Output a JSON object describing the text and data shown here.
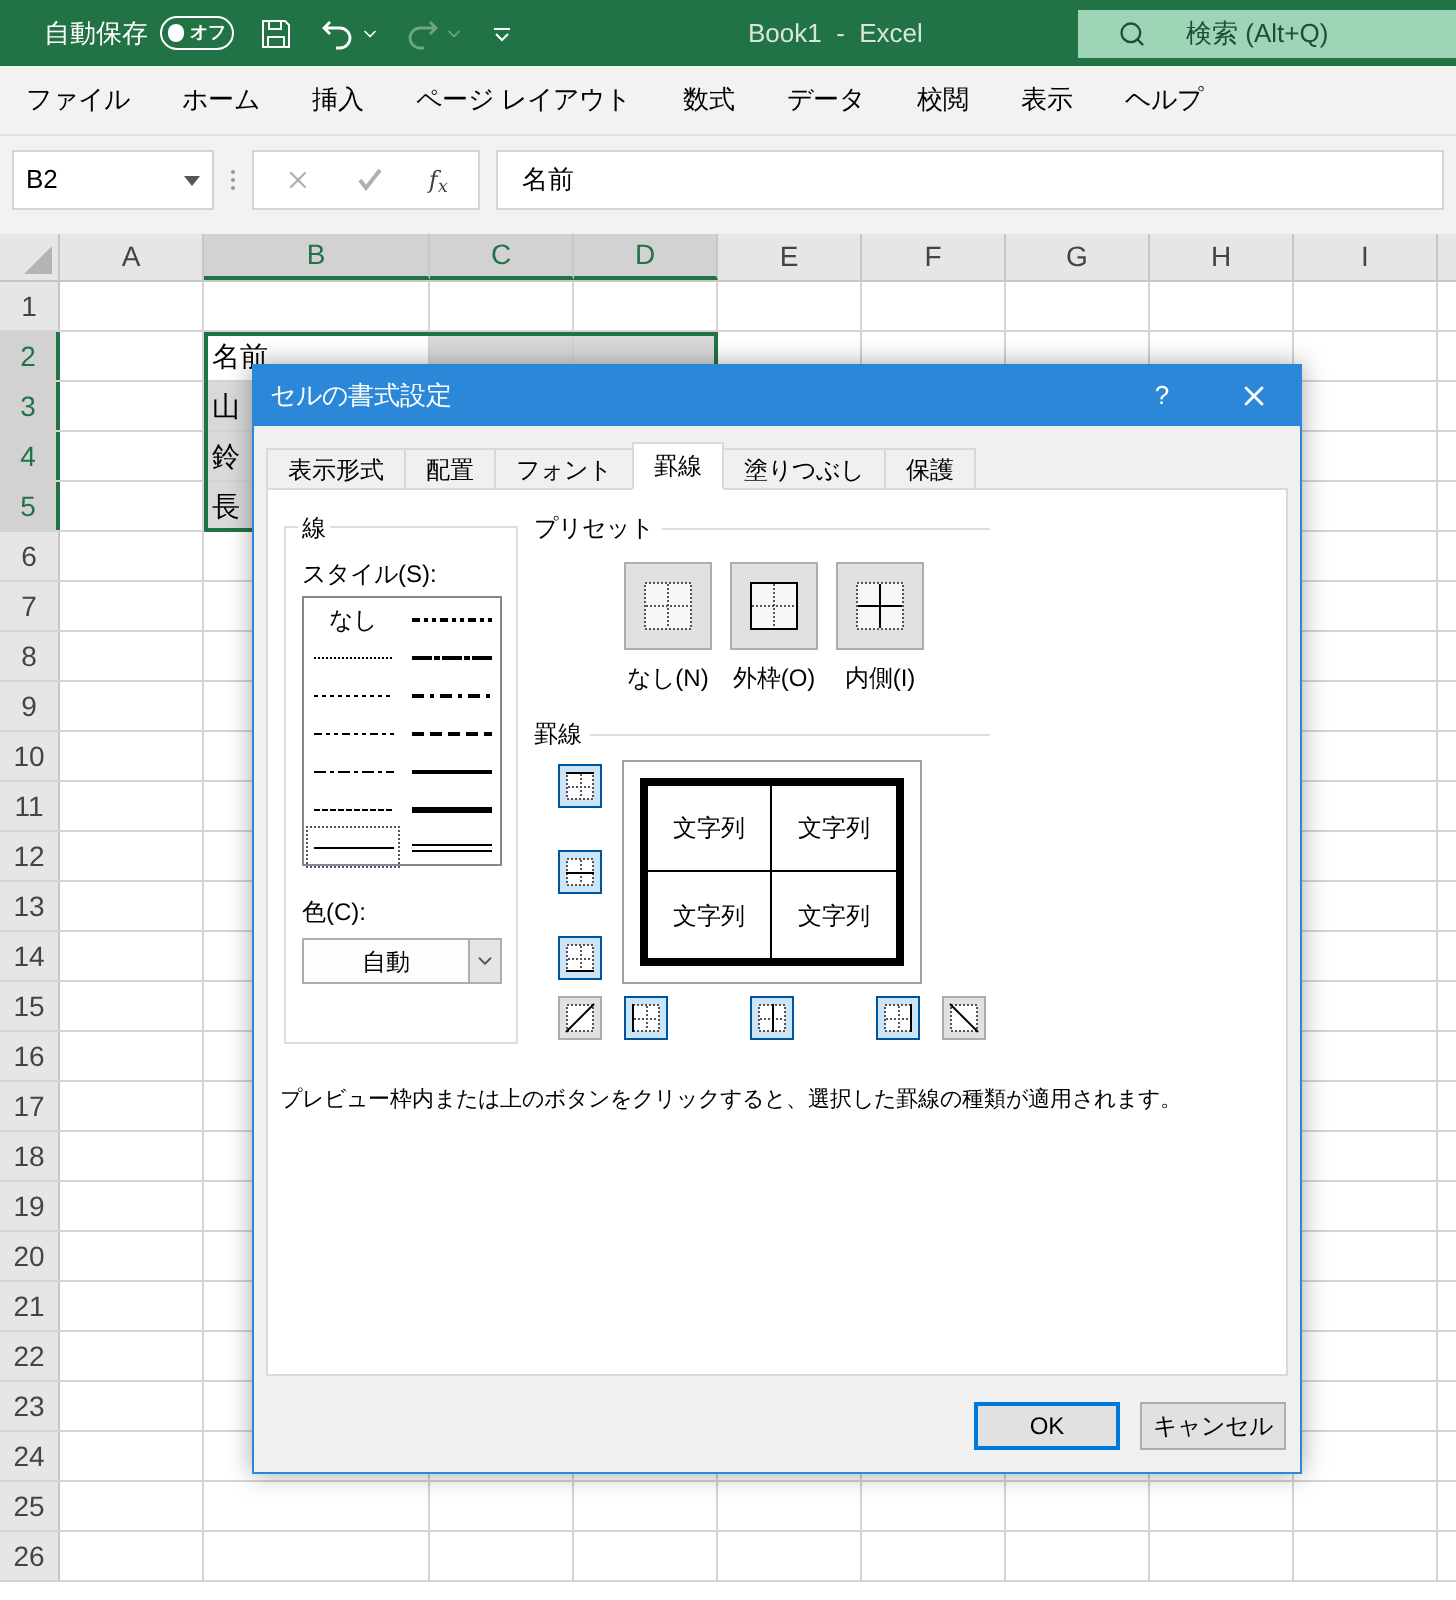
{
  "titlebar": {
    "autosave_label": "自動保存",
    "autosave": {
      "on": false,
      "label": "オフ"
    },
    "title": "Book1  -  Excel",
    "search": {
      "placeholder": "検索 (Alt+Q)"
    },
    "redo_disabled": true
  },
  "menu": [
    "ファイル",
    "ホーム",
    "挿入",
    "ページ レイアウト",
    "数式",
    "データ",
    "校閲",
    "表示",
    "ヘルプ"
  ],
  "formula_bar": {
    "name_box": "B2",
    "fx": "f$_{x}$",
    "value": "名前"
  },
  "sheet": {
    "columns": [
      {
        "label": "A",
        "selected": false
      },
      {
        "label": "B",
        "selected": true
      },
      {
        "label": "C",
        "selected": true
      },
      {
        "label": "D",
        "selected": true
      },
      {
        "label": "E",
        "selected": false
      },
      {
        "label": "F",
        "selected": false
      },
      {
        "label": "G",
        "selected": false
      },
      {
        "label": "H",
        "selected": false
      },
      {
        "label": "I",
        "selected": false
      }
    ],
    "rows": [
      {
        "label": "1",
        "selected": false
      },
      {
        "label": "2",
        "selected": true,
        "cells": [
          null,
          {
            "text": "名前",
            "selected": false
          },
          {
            "selected": true
          },
          {
            "selected": true
          }
        ]
      },
      {
        "label": "3",
        "selected": true,
        "cells": [
          null,
          {
            "text": "山",
            "selected": true
          }
        ]
      },
      {
        "label": "4",
        "selected": true,
        "cells": [
          null,
          {
            "text": "鈴",
            "selected": true
          }
        ]
      },
      {
        "label": "5",
        "selected": true,
        "cells": [
          null,
          {
            "text": "長",
            "selected": true
          }
        ]
      },
      {
        "label": "6",
        "selected": false
      },
      {
        "label": "7",
        "selected": false
      },
      {
        "label": "8",
        "selected": false
      },
      {
        "label": "9",
        "selected": false
      },
      {
        "label": "10",
        "selected": false
      },
      {
        "label": "11",
        "selected": false
      },
      {
        "label": "12",
        "selected": false
      },
      {
        "label": "13",
        "selected": false
      },
      {
        "label": "14",
        "selected": false
      },
      {
        "label": "15",
        "selected": false
      },
      {
        "label": "16",
        "selected": false
      },
      {
        "label": "17",
        "selected": false
      },
      {
        "label": "18",
        "selected": false
      },
      {
        "label": "19",
        "selected": false
      },
      {
        "label": "20",
        "selected": false
      },
      {
        "label": "21",
        "selected": false
      },
      {
        "label": "22",
        "selected": false
      },
      {
        "label": "23",
        "selected": false
      },
      {
        "label": "24",
        "selected": false
      },
      {
        "label": "25",
        "selected": false
      },
      {
        "label": "26",
        "selected": false
      }
    ]
  },
  "dialog": {
    "title": "セルの書式設定",
    "help": "?",
    "tabs": [
      {
        "label": "表示形式",
        "selected": false
      },
      {
        "label": "配置",
        "selected": false
      },
      {
        "label": "フォント",
        "selected": false
      },
      {
        "label": "罫線",
        "selected": true
      },
      {
        "label": "塗りつぶし",
        "selected": false
      },
      {
        "label": "保護",
        "selected": false
      }
    ],
    "line_group": {
      "title": "線",
      "style_label": "スタイル(S):",
      "styles": [
        {
          "kind": "none",
          "label": "なし",
          "selected": false
        },
        {
          "kind": "medium-dash-dot-dot",
          "selected": false
        },
        {
          "kind": "hair",
          "selected": false
        },
        {
          "kind": "slant-dash-dot",
          "selected": false
        },
        {
          "kind": "dotted",
          "selected": false
        },
        {
          "kind": "medium-dash-dot",
          "selected": false
        },
        {
          "kind": "dash-dot-dot",
          "selected": false
        },
        {
          "kind": "medium-dashed",
          "selected": false
        },
        {
          "kind": "dash-dot",
          "selected": false
        },
        {
          "kind": "medium",
          "selected": false
        },
        {
          "kind": "dashed",
          "selected": false
        },
        {
          "kind": "thick",
          "selected": false
        },
        {
          "kind": "thin",
          "selected": true
        },
        {
          "kind": "double",
          "selected": false
        }
      ],
      "color_label": "色(C):",
      "color_value": "自動"
    },
    "preset_title": "プリセット",
    "presets": [
      {
        "kind": "none",
        "label": "なし(N)"
      },
      {
        "kind": "outline",
        "label": "外枠(O)"
      },
      {
        "kind": "inside",
        "label": "内側(I)"
      }
    ],
    "border_title": "罫線",
    "border_buttons": [
      {
        "kind": "top",
        "selected": true
      },
      {
        "kind": "middle-h",
        "selected": true
      },
      {
        "kind": "bottom",
        "selected": true
      },
      {
        "kind": "diag-up",
        "selected": false
      },
      {
        "kind": "left",
        "selected": true
      },
      {
        "kind": "middle-v",
        "selected": true
      },
      {
        "kind": "right",
        "selected": true
      },
      {
        "kind": "diag-down",
        "selected": false
      }
    ],
    "preview_texts": [
      "文字列",
      "文字列",
      "文字列",
      "文字列"
    ],
    "hint": "プレビュー枠内または上のボタンをクリックすると、選択した罫線の種類が適用されます。",
    "buttons": [
      {
        "label": "OK",
        "default": true
      },
      {
        "label": "キャンセル",
        "default": false
      }
    ]
  }
}
